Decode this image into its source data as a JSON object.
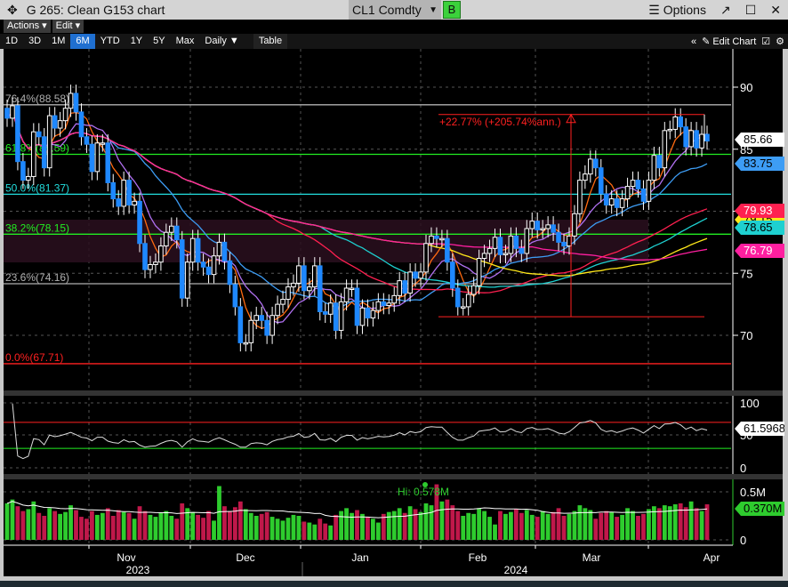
{
  "window": {
    "title": "G 265: Clean G153 chart",
    "ticker": "CL1 Comdty",
    "ticker_button": "B",
    "options": "Options",
    "options_icon": "hamburger-icon"
  },
  "menus": {
    "actions": "Actions ▾",
    "edit": "Edit ▾"
  },
  "toolbar": {
    "tabs": [
      "1D",
      "3D",
      "1M",
      "6M",
      "YTD",
      "1Y",
      "5Y",
      "Max",
      "Daily ▼",
      "Table"
    ],
    "selected": "6M",
    "collapse": "«",
    "edit_chart": "✎ Edit Chart"
  },
  "colors": {
    "up": "#ffffff",
    "down": "#1e88ff",
    "vol_up": "#2ecc2e",
    "vol_down": "#c0184a",
    "selected_tab": "#1f6fd0"
  },
  "fibonacci": [
    {
      "label": "76.4%(88.58)",
      "price": 88.58,
      "color": "#b0b0b0"
    },
    {
      "label": "61.8%(84.59)",
      "price": 84.59,
      "color": "#22ee22"
    },
    {
      "label": "50.0%(81.37)",
      "price": 81.37,
      "color": "#22dddd"
    },
    {
      "label": "38.2%(78.15)",
      "price": 78.15,
      "color": "#22ee22"
    },
    {
      "label": "23.6%(74.16)",
      "price": 74.16,
      "color": "#b0b0b0"
    },
    {
      "label": "0.0%(67.71)",
      "price": 67.71,
      "color": "#ff2020"
    }
  ],
  "measure": {
    "text": "+22.77% (+205.74%ann.)",
    "from": 71.5,
    "to": 87.8
  },
  "price_axis": {
    "ticks": [
      90,
      85,
      80,
      75,
      70
    ],
    "min": 67,
    "max": 93
  },
  "price_labels": [
    {
      "value": "85.66",
      "bg": "#ffffff",
      "fg": "#000000"
    },
    {
      "value": "83.75",
      "bg": "#3d9df5",
      "fg": "#000000"
    },
    {
      "value": "79.93",
      "bg": "#ff2050",
      "fg": "#ffffff"
    },
    {
      "value": "79.15",
      "bg": "#ffe81a",
      "fg": "#000000"
    },
    {
      "value": "78.65",
      "bg": "#1ed0d0",
      "fg": "#000000"
    },
    {
      "value": "76.79",
      "bg": "#ff1fa0",
      "fg": "#ffffff"
    }
  ],
  "moving_averages": [
    {
      "period": 5,
      "color": "#ff6a10"
    },
    {
      "period": 9,
      "color": "#b070f0"
    },
    {
      "period": 20,
      "color": "#3d9df5"
    },
    {
      "period": 50,
      "color": "#ff2050"
    },
    {
      "period": 60,
      "color": "#1ed0d0"
    },
    {
      "period": 80,
      "color": "#ffe81a"
    },
    {
      "period": 100,
      "color": "#ff1fa0"
    }
  ],
  "rsi": {
    "ticks": [
      "100",
      "50",
      "0"
    ],
    "value": "61.5968",
    "upper": 70,
    "lower": 30
  },
  "volume": {
    "ticks": [
      "0.5M",
      "0"
    ],
    "value": "0.370M",
    "high_label": "Hi: 0.578M"
  },
  "x_axis": {
    "months": [
      "Nov",
      "Dec",
      "Jan",
      "Feb",
      "Mar",
      "Apr"
    ],
    "years": [
      "2023",
      "2024"
    ]
  },
  "closes": [
    87.5,
    88.5,
    84,
    82.5,
    82.8,
    86.4,
    86,
    83.5,
    87.7,
    86.7,
    87.3,
    88.3,
    89.5,
    88,
    86,
    85.4,
    83.2,
    85.5,
    85.5,
    82.3,
    81,
    80.4,
    82.5,
    80.5,
    80.8,
    77.4,
    75.3,
    75.7,
    75.9,
    77.2,
    78.3,
    78.8,
    77.7,
    73,
    75.9,
    77.8,
    75.9,
    75.5,
    74.9,
    76.4,
    77.5,
    76,
    74.1,
    72.3,
    69.4,
    69.4,
    71.2,
    71.6,
    71.2,
    70,
    71.6,
    72.5,
    72.9,
    73.9,
    74.2,
    75.6,
    73.6,
    73.9,
    75.6,
    71.9,
    71.7,
    72.6,
    70.4,
    72.7,
    73.8,
    73.8,
    70.8,
    72.2,
    71.4,
    72,
    72.7,
    72.4,
    72.6,
    73.2,
    74.4,
    73.4,
    75.1,
    74.6,
    75.1,
    77.4,
    78,
    77.8,
    77.8,
    75.9,
    73.8,
    72.3,
    72.3,
    73.3,
    74,
    76.2,
    76.6,
    77,
    77.9,
    76.5,
    76.6,
    78,
    77,
    76.6,
    78.6,
    79.2,
    78.5,
    78.6,
    78.9,
    78.3,
    77.5,
    77.2,
    78,
    79.8,
    82.5,
    83,
    84.2,
    83.5,
    81.4,
    80.5,
    81,
    80.3,
    81,
    82,
    82.5,
    81.8,
    80.8,
    82.5,
    84.5,
    83.5,
    86.5,
    86.6,
    87.6,
    86.8,
    85.2,
    86.5,
    85.1,
    86.2,
    85.66
  ],
  "volumes": [
    0.38,
    0.42,
    0.35,
    0.3,
    0.32,
    0.4,
    0.28,
    0.25,
    0.33,
    0.3,
    0.27,
    0.29,
    0.36,
    0.31,
    0.24,
    0.22,
    0.3,
    0.26,
    0.28,
    0.33,
    0.25,
    0.31,
    0.29,
    0.28,
    0.22,
    0.35,
    0.3,
    0.26,
    0.24,
    0.28,
    0.3,
    0.25,
    0.22,
    0.38,
    0.33,
    0.29,
    0.26,
    0.23,
    0.3,
    0.2,
    0.56,
    0.35,
    0.3,
    0.34,
    0.4,
    0.32,
    0.28,
    0.25,
    0.27,
    0.29,
    0.24,
    0.22,
    0.2,
    0.23,
    0.26,
    0.25,
    0.19,
    0.18,
    0.16,
    0.22,
    0.17,
    0.15,
    0.26,
    0.3,
    0.33,
    0.28,
    0.31,
    0.27,
    0.24,
    0.22,
    0.18,
    0.27,
    0.29,
    0.3,
    0.33,
    0.28,
    0.35,
    0.32,
    0.29,
    0.38,
    0.36,
    0.578,
    0.4,
    0.42,
    0.36,
    0.3,
    0.25,
    0.28,
    0.27,
    0.33,
    0.3,
    0.24,
    0.16,
    0.3,
    0.27,
    0.29,
    0.32,
    0.28,
    0.31,
    0.26,
    0.24,
    0.3,
    0.27,
    0.29,
    0.33,
    0.25,
    0.27,
    0.3,
    0.36,
    0.33,
    0.31,
    0.22,
    0.28,
    0.3,
    0.29,
    0.24,
    0.26,
    0.33,
    0.3,
    0.25,
    0.27,
    0.32,
    0.35,
    0.33,
    0.36,
    0.35,
    0.37,
    0.38,
    0.34,
    0.4,
    0.33,
    0.3,
    0.37
  ]
}
